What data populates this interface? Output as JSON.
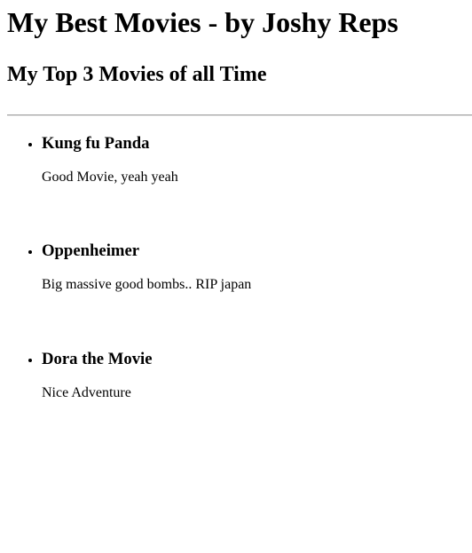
{
  "header": {
    "title": "My Best Movies - by Joshy Reps",
    "subtitle": "My Top 3 Movies of all Time"
  },
  "movies": [
    {
      "title": "Kung fu Panda",
      "description": "Good Movie, yeah yeah"
    },
    {
      "title": "Oppenheimer",
      "description": "Big massive good bombs.. RIP japan"
    },
    {
      "title": "Dora the Movie",
      "description": "Nice Adventure"
    }
  ]
}
